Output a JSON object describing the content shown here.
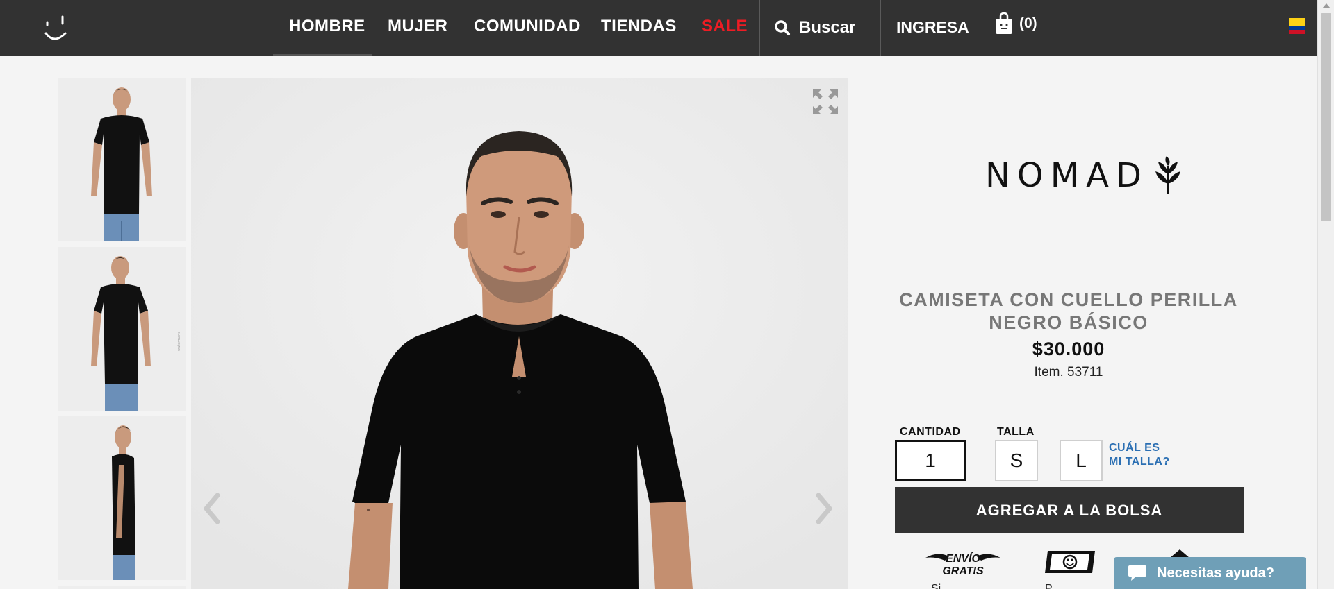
{
  "header": {
    "nav": [
      "HOMBRE",
      "MUJER",
      "COMUNIDAD",
      "TIENDAS",
      "SALE"
    ],
    "search_label": "Buscar",
    "login_label": "INGRESA",
    "cart_count": "(0)"
  },
  "product": {
    "brand": "NOMAD",
    "title_line1": "CAMISETA CON CUELLO PERILLA",
    "title_line2": "NEGRO BÁSICO",
    "price": "$30.000",
    "item_number": "Item. 53711",
    "quantity_label": "CANTIDAD",
    "quantity_value": "1",
    "size_label": "TALLA",
    "sizes": [
      "S",
      "L"
    ],
    "size_guide_line1": "CUÁL ES",
    "size_guide_line2": "MI TALLA?",
    "add_to_bag": "AGREGAR A LA BOLSA"
  },
  "badges": {
    "free_shipping_line1": "ENVÍO",
    "free_shipping_line2": "GRATIS",
    "free_shipping_caption": "Si",
    "payment_caption": "P"
  },
  "chat": {
    "label": "Necesitas ayuda?"
  },
  "colors": {
    "header_bg": "#323232",
    "sale_red": "#ee1c24",
    "link_blue": "#2b6fb3",
    "chat_bg": "#6f9fb7"
  }
}
